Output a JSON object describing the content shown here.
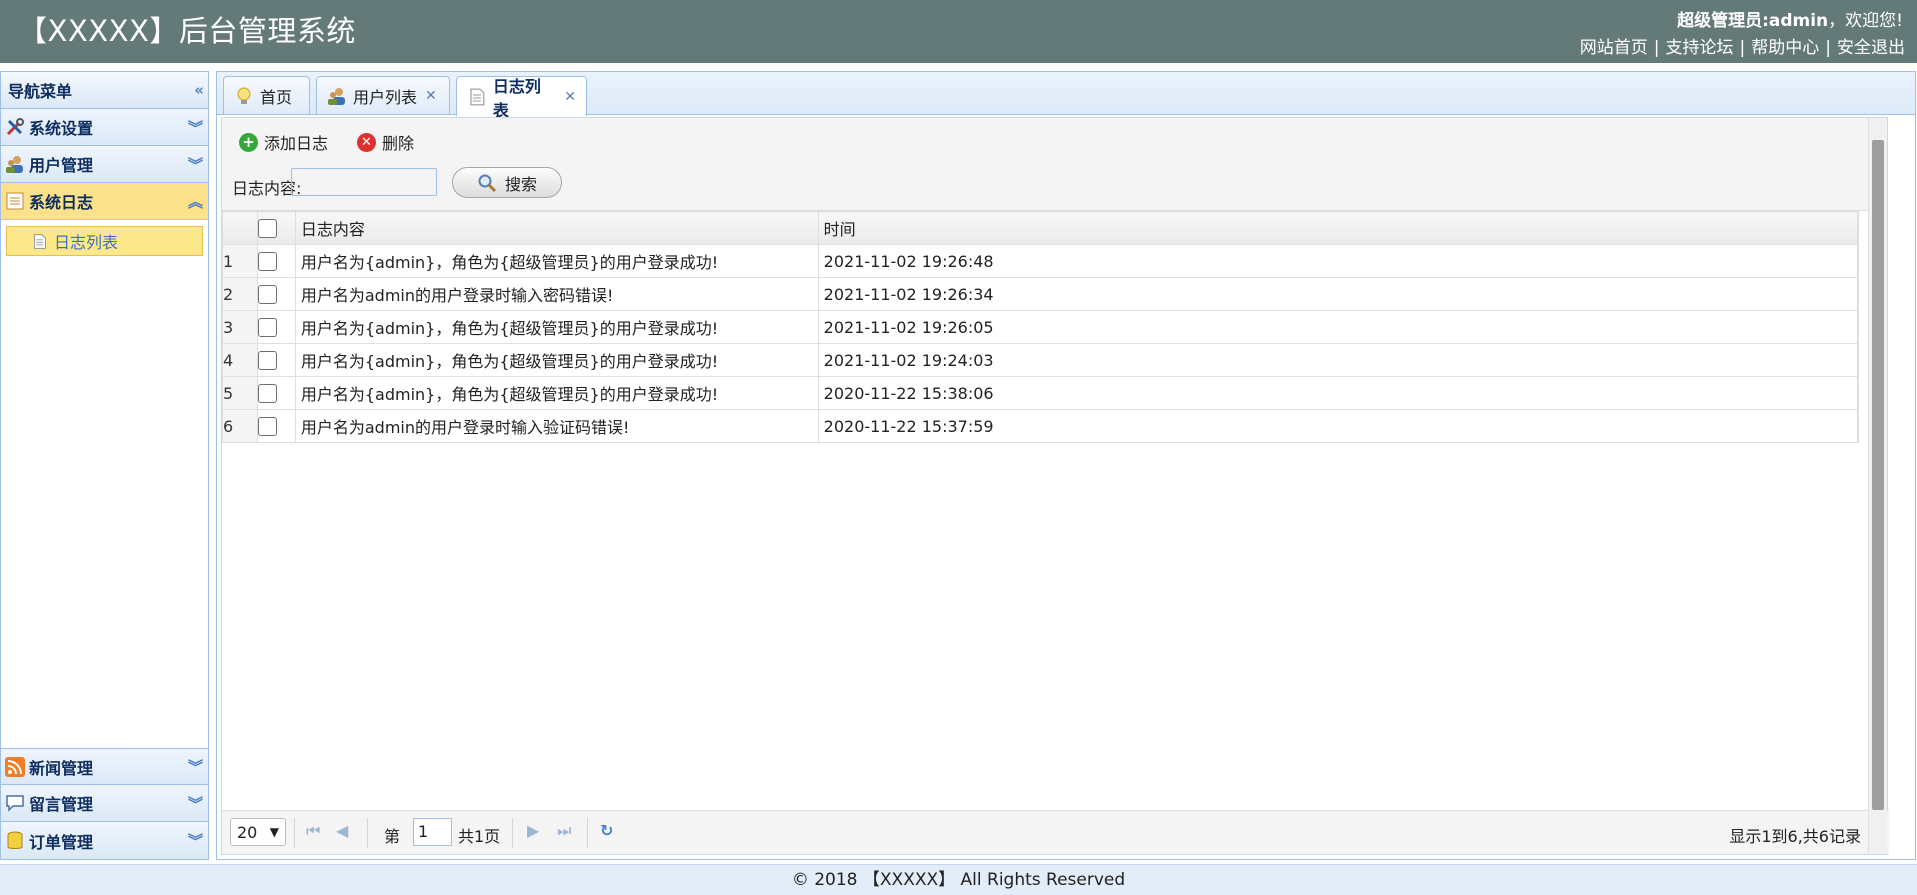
{
  "header": {
    "title": "【XXXXX】后台管理系统",
    "user_role_label": "超级管理员:admin",
    "welcome": "，欢迎您!",
    "links": [
      "网站首页",
      "支持论坛",
      "帮助中心",
      "安全退出"
    ]
  },
  "sidebar": {
    "title": "导航菜单",
    "top_items": [
      {
        "label": "系统设置",
        "icon": "tools-icon"
      },
      {
        "label": "用户管理",
        "icon": "users-icon"
      },
      {
        "label": "系统日志",
        "icon": "log-icon"
      }
    ],
    "sub_item": "日志列表",
    "bottom_items": [
      {
        "label": "新闻管理",
        "icon": "rss-icon"
      },
      {
        "label": "留言管理",
        "icon": "comment-icon"
      },
      {
        "label": "订单管理",
        "icon": "database-icon"
      }
    ]
  },
  "tabs": [
    {
      "label": "首页",
      "icon": "bulb-icon",
      "closable": false
    },
    {
      "label": "用户列表",
      "icon": "users-icon",
      "closable": true
    },
    {
      "label": "日志列表",
      "icon": "document-icon",
      "closable": true
    }
  ],
  "toolbar": {
    "add_label": "添加日志",
    "delete_label": "删除",
    "search_label": "日志内容:",
    "search_value": "",
    "search_button": "搜索"
  },
  "table": {
    "columns": [
      "日志内容",
      "时间"
    ],
    "rows": [
      {
        "num": "1",
        "content": "用户名为{admin}，角色为{超级管理员}的用户登录成功!",
        "time": "2021-11-02 19:26:48"
      },
      {
        "num": "2",
        "content": "用户名为admin的用户登录时输入密码错误!",
        "time": "2021-11-02 19:26:34"
      },
      {
        "num": "3",
        "content": "用户名为{admin}，角色为{超级管理员}的用户登录成功!",
        "time": "2021-11-02 19:26:05"
      },
      {
        "num": "4",
        "content": "用户名为{admin}，角色为{超级管理员}的用户登录成功!",
        "time": "2021-11-02 19:24:03"
      },
      {
        "num": "5",
        "content": "用户名为{admin}，角色为{超级管理员}的用户登录成功!",
        "time": "2020-11-22 15:38:06"
      },
      {
        "num": "6",
        "content": "用户名为admin的用户登录时输入验证码错误!",
        "time": "2020-11-22 15:37:59"
      }
    ]
  },
  "pager": {
    "page_size": "20",
    "page_prefix": "第",
    "page_value": "1",
    "page_suffix": "共1页",
    "summary": "显示1到6,共6记录"
  },
  "footer": "© 2018 【XXXXX】 All Rights Reserved",
  "colors": {
    "header_bg": "#647a78",
    "accent_border": "#9ec0e6",
    "active_menu": "#fbe28a"
  }
}
